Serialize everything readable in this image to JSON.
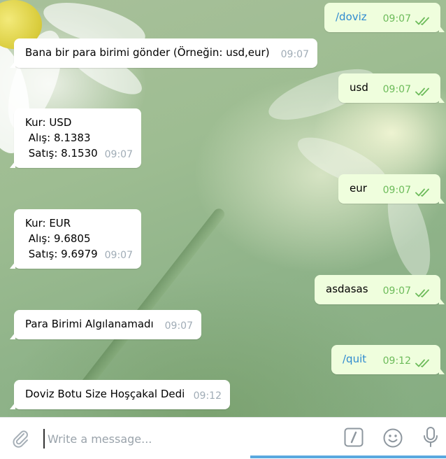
{
  "messages": [
    {
      "dir": "out",
      "text": "/doviz",
      "time": "09:07",
      "cmd": true
    },
    {
      "dir": "in",
      "text": "Bana bir para birimi gönder (Örneğin: usd,eur)",
      "time": "09:07"
    },
    {
      "dir": "out",
      "text": "usd",
      "time": "09:07"
    },
    {
      "dir": "in",
      "text": "Kur: USD\n Alış: 8.1383\n Satış: 8.1530",
      "time": "09:07"
    },
    {
      "dir": "out",
      "text": "eur",
      "time": "09:07"
    },
    {
      "dir": "in",
      "text": "Kur: EUR\n Alış: 9.6805\n Satış: 9.6979",
      "time": "09:07"
    },
    {
      "dir": "out",
      "text": "asdasas",
      "time": "09:07"
    },
    {
      "dir": "in",
      "text": "Para Birimi Algılanamadı",
      "time": "09:07"
    },
    {
      "dir": "out",
      "text": "/quit",
      "time": "09:12",
      "cmd": true
    },
    {
      "dir": "in",
      "text": "Doviz Botu Size Hoşçakal Dedi",
      "time": "09:12"
    }
  ],
  "composer": {
    "placeholder": "Write a message...",
    "icons": [
      "paperclip-icon",
      "slash-command-icon",
      "emoji-icon",
      "microphone-icon"
    ]
  },
  "colors": {
    "incoming_bubble": "#ffffff",
    "outgoing_bubble": "#effedd",
    "command_link": "#2f8bd0",
    "read_check": "#6cbb5a"
  }
}
